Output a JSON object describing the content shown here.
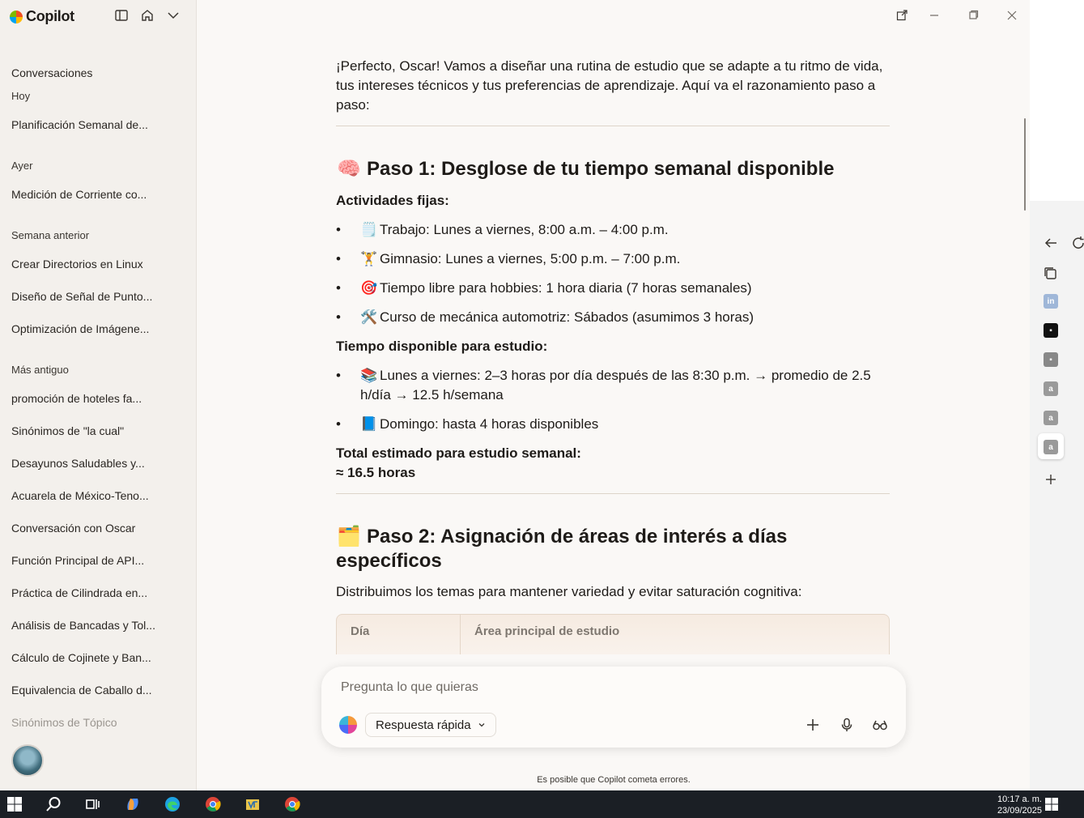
{
  "app": {
    "name": "Copilot"
  },
  "sidebar": {
    "section_title": "Conversaciones",
    "groups": [
      {
        "label": "Hoy",
        "items": [
          "Planificación Semanal de..."
        ]
      },
      {
        "label": "Ayer",
        "items": [
          "Medición de Corriente co..."
        ]
      },
      {
        "label": "Semana anterior",
        "items": [
          "Crear Directorios en Linux",
          "Diseño de Señal de Punto...",
          "Optimización de Imágene..."
        ]
      },
      {
        "label": "Más antiguo",
        "items": [
          "promoción de hoteles fa...",
          "Sinónimos de \"la cual\"",
          "Desayunos Saludables y...",
          "Acuarela de México-Teno...",
          "Conversación con Oscar",
          "Función Principal de API...",
          "Práctica de Cilindrada en...",
          "Análisis de Bancadas y Tol...",
          "Cálculo de Cojinete y Ban...",
          "Equivalencia de Caballo d...",
          "Sinónimos de Tópico"
        ]
      }
    ]
  },
  "message": {
    "intro": "¡Perfecto, Oscar! Vamos a diseñar una rutina de estudio que se adapte a tu ritmo de vida, tus intereses técnicos y tus preferencias de aprendizaje. Aquí va el razonamiento paso a paso:",
    "step1": {
      "emoji": "🧠",
      "title": "Paso 1: Desglose de tu tiempo semanal disponible",
      "fixed_label": "Actividades fijas:",
      "fixed": [
        {
          "emoji": "🗒️",
          "text": "Trabajo: Lunes a viernes, 8:00 a.m. – 4:00 p.m."
        },
        {
          "emoji": "🏋️",
          "text": "Gimnasio: Lunes a viernes, 5:00 p.m. – 7:00 p.m."
        },
        {
          "emoji": "🎯",
          "text": "Tiempo libre para hobbies: 1 hora diaria (7 horas semanales)"
        },
        {
          "emoji": "🛠️",
          "text": "Curso de mecánica automotriz: Sábados (asumimos 3 horas)"
        }
      ],
      "available_label": "Tiempo disponible para estudio:",
      "available": [
        {
          "emoji": "📚",
          "text": "Lunes a viernes: 2–3 horas por día después de las 8:30 p.m. → promedio de 2.5 h/día → 12.5 h/semana"
        },
        {
          "emoji": "📘",
          "text": "Domingo: hasta 4 horas disponibles"
        }
      ],
      "total_label": "Total estimado para estudio semanal:",
      "total_value": "≈ 16.5 horas"
    },
    "step2": {
      "emoji": "🗂️",
      "title": "Paso 2: Asignación de áreas de interés a días específicos",
      "description": "Distribuimos los temas para mantener variedad y evitar saturación cognitiva:",
      "table_headers": [
        "Día",
        "Área principal de estudio"
      ]
    }
  },
  "composer": {
    "placeholder": "Pregunta lo que quieras",
    "mode_label": "Respuesta rápida"
  },
  "disclaimer": "Es posible que Copilot cometa errores.",
  "taskbar": {
    "time": "10:17 a. m.",
    "date": "23/09/2025"
  }
}
